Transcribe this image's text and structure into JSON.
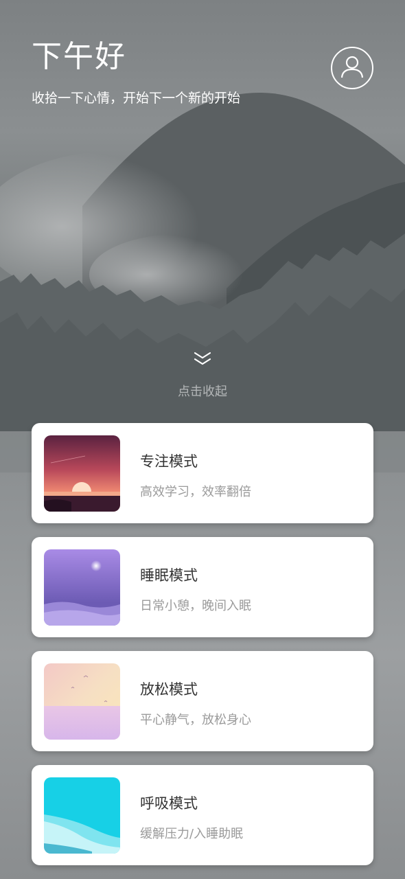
{
  "header": {
    "greeting": "下午好",
    "subtitle": "收拾一下心情，开始下一个新的开始",
    "avatar_icon": "user-avatar-icon"
  },
  "collapse": {
    "icon": "double-chevron-down-icon",
    "label": "点击收起"
  },
  "modes": [
    {
      "title": "专注模式",
      "desc": "高效学习，效率翻倍",
      "thumb": "sunset-scene"
    },
    {
      "title": "睡眠模式",
      "desc": "日常小憩，晚间入眠",
      "thumb": "night-dunes-scene"
    },
    {
      "title": "放松模式",
      "desc": "平心静气，放松身心",
      "thumb": "pastel-sea-scene"
    },
    {
      "title": "呼吸模式",
      "desc": "缓解压力/入睡助眠",
      "thumb": "cyan-waves-scene"
    }
  ],
  "colors": {
    "card_bg": "#ffffff",
    "title_text": "#333333",
    "desc_text": "#9a9a9a"
  }
}
